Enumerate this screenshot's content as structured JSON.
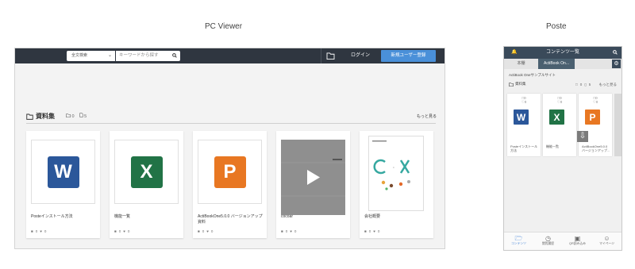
{
  "captions": {
    "pc": "PC Viewer",
    "poste": "Poste"
  },
  "pc": {
    "search_scope": "全文検索",
    "search_placeholder": "キーワードから探す",
    "login_label": "ログイン",
    "register_label": "新規ユーザー登録",
    "section_title": "資料集",
    "folder_count": "0",
    "file_count": "5",
    "more_label": "もっと見る",
    "cards": [
      {
        "title": "Posteインストール方法",
        "comments": "0",
        "likes": "0",
        "type": "word",
        "letter": "W"
      },
      {
        "title": "機能一覧",
        "comments": "0",
        "likes": "0",
        "type": "excel",
        "letter": "X"
      },
      {
        "title": "ActiBookOne5.0.0 バージョンアップ資料",
        "comments": "0",
        "likes": "0",
        "type": "ppt",
        "letter": "P"
      },
      {
        "title": "cocoar",
        "comments": "0",
        "likes": "0",
        "type": "video",
        "letter": ""
      },
      {
        "title": "会社概要",
        "comments": "0",
        "likes": "0",
        "type": "document",
        "letter": ""
      }
    ]
  },
  "poste": {
    "header_title": "コンテンツ一覧",
    "tabs": [
      "本棚",
      "ActiBook On..."
    ],
    "site_name": "ActiBook Oneサンプルサイト",
    "folder_label": "資料集",
    "folder_count": "0",
    "file_count": "5",
    "more_label": "もっと見る",
    "cards": [
      {
        "title": "Posteインストール方法",
        "comments": "0",
        "likes": "0",
        "letter": "W"
      },
      {
        "title": "機能一覧",
        "comments": "0",
        "likes": "0",
        "letter": "X"
      },
      {
        "title": "ActiBookOne5.0.0バージョンアップ...",
        "comments": "0",
        "likes": "0",
        "letter": "P"
      }
    ],
    "nav": [
      "コンテンツ",
      "閲覧履歴",
      "QR読み込み",
      "マイページ"
    ]
  },
  "colors": {
    "accent": "#4a90d9",
    "word": "#2b579a",
    "excel": "#217346",
    "ppt": "#e87722",
    "topbar": "#2f3640"
  }
}
